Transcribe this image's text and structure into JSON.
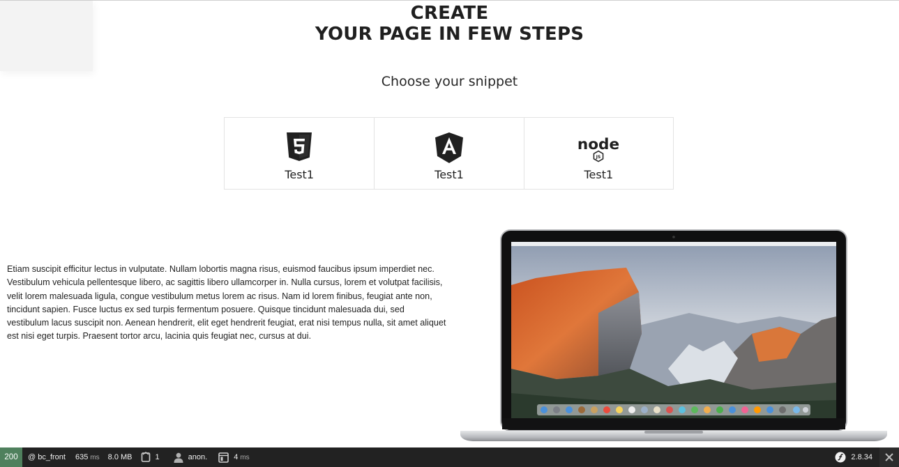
{
  "hero": {
    "line1": "CREATE",
    "line2": "YOUR PAGE IN FEW STEPS"
  },
  "subtitle": "Choose your snippet",
  "snippets": [
    {
      "label": "Test1",
      "icon": "html5-icon"
    },
    {
      "label": "Test1",
      "icon": "angular-icon"
    },
    {
      "label": "Test1",
      "icon": "nodejs-icon"
    }
  ],
  "nodejs_logo_text": {
    "main": "node",
    "badge": "JS"
  },
  "paragraph": "Etiam suscipit efficitur lectus in vulputate. Nullam lobortis magna risus, euismod faucibus ipsum imperdiet nec. Vestibulum vehicula pellentesque libero, ac sagittis libero ullamcorper in. Nulla cursus, lorem et volutpat facilisis, velit lorem malesuada ligula, congue vestibulum metus lorem ac risus. Nam id lorem finibus, feugiat ante non, tincidunt sapien. Fusce luctus ex sed turpis fermentum posuere. Quisque tincidunt malesuada dui, sed vestibulum lacus suscipit non. Aenean hendrerit, elit eget hendrerit feugiat, erat nisi tempus nulla, sit amet aliquet est nisi eget turpis. Praesent tortor arcu, lacinia quis feugiat nec, cursus at dui.",
  "laptop_image": {
    "icon": "macbook-laptop-image"
  },
  "toolbar": {
    "status_code": "200",
    "route": "@ bc_front",
    "time_value": "635",
    "time_unit": "ms",
    "memory": "8.0 MB",
    "forms_count": "1",
    "user": "anon.",
    "twig_time_value": "4",
    "twig_time_unit": "ms",
    "version": "2.8.34"
  },
  "colors": {
    "toolbar_bg": "#222222",
    "status_ok": "#4f805d",
    "logo_dark": "#202020"
  }
}
